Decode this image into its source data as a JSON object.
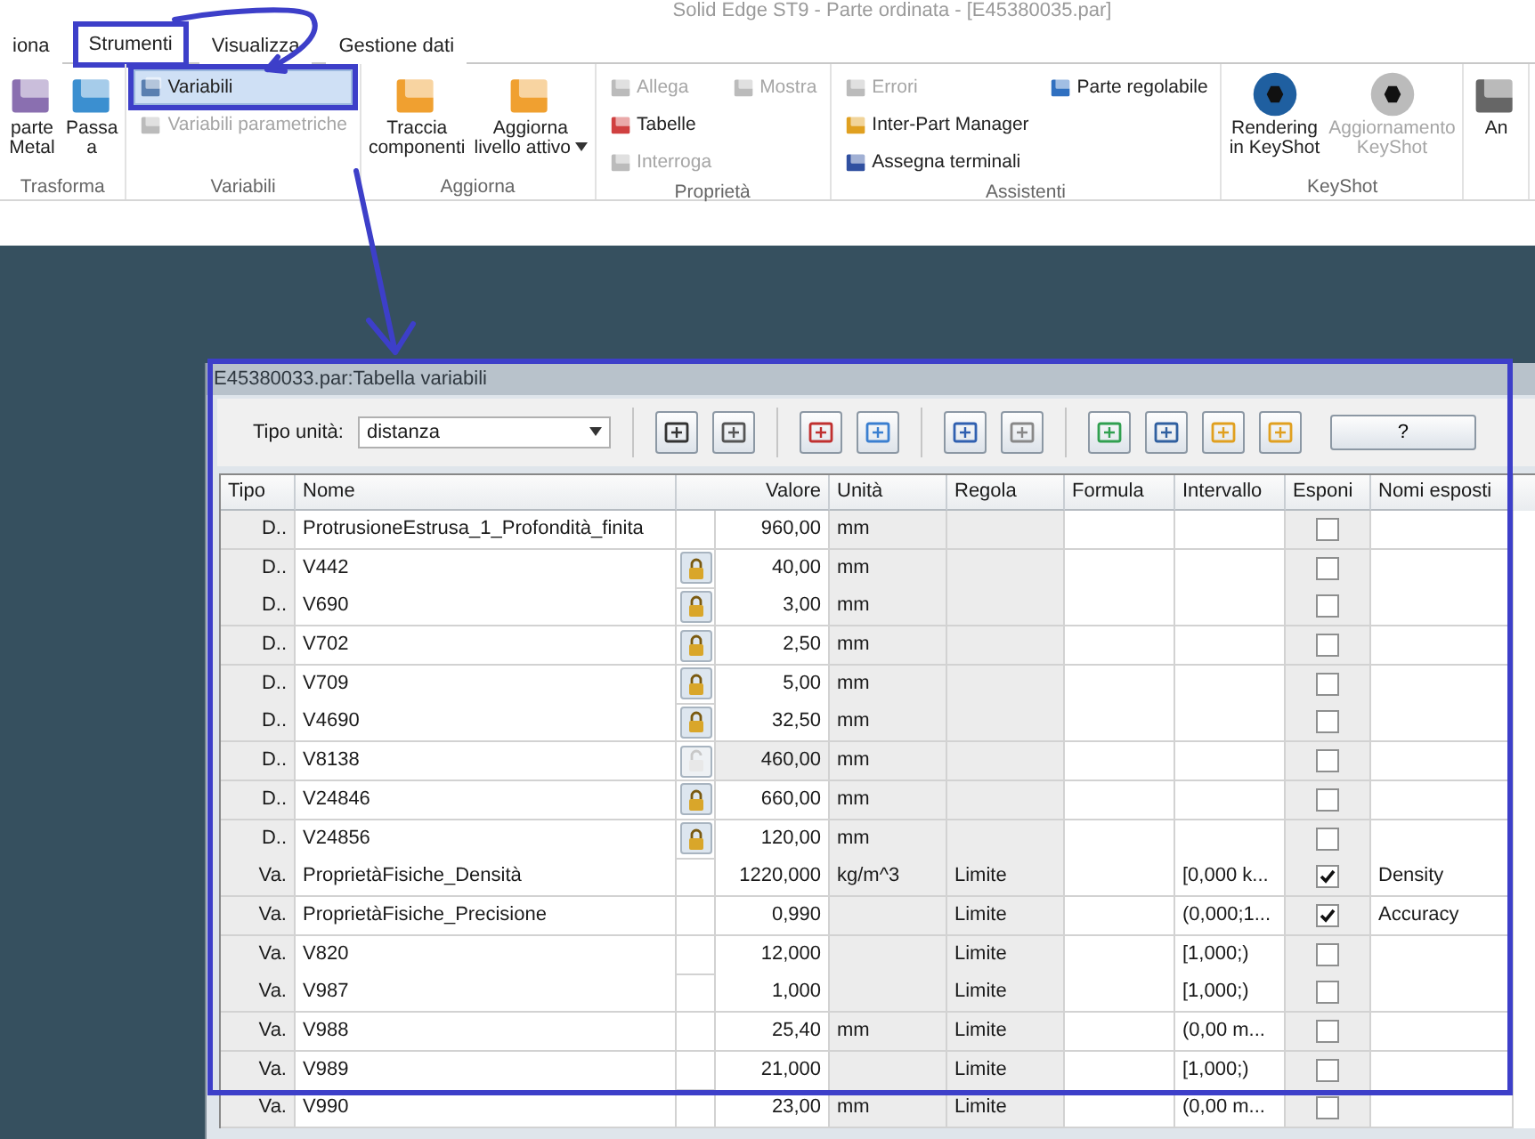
{
  "app_title": "Solid Edge ST9 - Parte ordinata - [E45380035.par]",
  "tabs": [
    {
      "label": "iona",
      "selected": false
    },
    {
      "label": "Strumenti",
      "selected": true
    },
    {
      "label": "Visualizza",
      "selected": false
    },
    {
      "label": "Gestione dati",
      "selected": false
    }
  ],
  "ribbon_groups": [
    {
      "label": "Trasforma",
      "columns": [
        [
          {
            "kind": "large",
            "label": "parte\nMetal",
            "disabled": false,
            "active": false
          }
        ],
        [
          {
            "kind": "large",
            "label": "Passa\na",
            "disabled": false,
            "active": false
          }
        ]
      ]
    },
    {
      "label": "Variabili",
      "columns": [
        [
          {
            "kind": "small",
            "label": "Variabili",
            "disabled": false,
            "active": true
          },
          {
            "kind": "small",
            "label": "Variabili parametriche",
            "disabled": true,
            "active": false
          }
        ]
      ]
    },
    {
      "label": "Aggiorna",
      "columns": [
        [
          {
            "kind": "large",
            "label": "Traccia\ncomponenti",
            "disabled": false,
            "active": false
          }
        ],
        [
          {
            "kind": "large",
            "label": "Aggiorna\nlivello attivo",
            "dropdown": true,
            "disabled": false,
            "active": false
          }
        ]
      ]
    },
    {
      "label": "Proprietà",
      "columns": [
        [
          {
            "kind": "small",
            "label": "Allega",
            "disabled": true,
            "active": false
          },
          {
            "kind": "small",
            "label": "Tabelle",
            "disabled": false,
            "active": false
          },
          {
            "kind": "small",
            "label": "Interroga",
            "disabled": true,
            "active": false
          }
        ],
        [
          {
            "kind": "small",
            "label": "Mostra",
            "disabled": true,
            "active": false
          }
        ]
      ]
    },
    {
      "label": "Assistenti",
      "columns": [
        [
          {
            "kind": "small",
            "label": "Errori",
            "disabled": true,
            "active": false
          },
          {
            "kind": "small",
            "label": "Inter-Part Manager",
            "disabled": false,
            "active": false
          },
          {
            "kind": "small",
            "label": "Assegna terminali",
            "disabled": false,
            "active": false
          }
        ],
        [
          {
            "kind": "small",
            "label": "Parte regolabile",
            "disabled": false,
            "active": false
          }
        ]
      ]
    },
    {
      "label": "KeyShot",
      "columns": [
        [
          {
            "kind": "large",
            "label": "Rendering\nin KeyShot",
            "disabled": false,
            "active": false
          }
        ],
        [
          {
            "kind": "large",
            "label": "Aggiornamento\nKeyShot",
            "disabled": true,
            "active": false
          }
        ]
      ]
    },
    {
      "columns": [
        [
          {
            "kind": "large",
            "label": "An",
            "disabled": false,
            "active": false
          }
        ]
      ]
    }
  ],
  "dialog": {
    "title": "E45380033.par:Tabella variabili",
    "unit_label": "Tipo unità:",
    "unit_value": "distanza",
    "help_label": "?"
  },
  "table": {
    "columns": [
      "Tipo",
      "Nome",
      "Valore",
      "Unità",
      "Regola",
      "Formula",
      "Intervallo",
      "Esponi",
      "Nomi esposti"
    ],
    "rows": [
      {
        "tipo": "D..",
        "nome": "ProtrusioneEstrusa_1_Profondità_finita",
        "lock_button": false,
        "valore": "960,00",
        "unita": "mm",
        "regola": "",
        "intervallo": "",
        "esponi": false,
        "nome_esposto": ""
      },
      {
        "tipo": "D..",
        "nome": "V442",
        "lock_button": true,
        "locked": true,
        "valore": "40,00",
        "unita": "mm",
        "regola": "",
        "intervallo": "",
        "esponi": false,
        "nome_esposto": ""
      },
      {
        "tipo": "D..",
        "nome": "V690",
        "lock_button": true,
        "locked": true,
        "valore": "3,00",
        "unita": "mm",
        "regola": "",
        "intervallo": "",
        "esponi": false,
        "nome_esposto": ""
      },
      {
        "tipo": "D..",
        "nome": "V702",
        "lock_button": true,
        "locked": true,
        "valore": "2,50",
        "unita": "mm",
        "regola": "",
        "intervallo": "",
        "esponi": false,
        "nome_esposto": ""
      },
      {
        "tipo": "D..",
        "nome": "V709",
        "lock_button": true,
        "locked": true,
        "valore": "5,00",
        "unita": "mm",
        "regola": "",
        "intervallo": "",
        "esponi": false,
        "nome_esposto": ""
      },
      {
        "tipo": "D..",
        "nome": "V4690",
        "lock_button": true,
        "locked": true,
        "valore": "32,50",
        "unita": "mm",
        "regola": "",
        "intervallo": "",
        "esponi": false,
        "nome_esposto": ""
      },
      {
        "tipo": "D..",
        "nome": "V8138",
        "lock_button": true,
        "locked": false,
        "valore": "460,00",
        "unita": "mm",
        "regola": "",
        "intervallo": "",
        "esponi": false,
        "nome_esposto": ""
      },
      {
        "tipo": "D..",
        "nome": "V24846",
        "lock_button": true,
        "locked": true,
        "valore": "660,00",
        "unita": "mm",
        "regola": "",
        "intervallo": "",
        "esponi": false,
        "nome_esposto": ""
      },
      {
        "tipo": "D..",
        "nome": "V24856",
        "lock_button": true,
        "locked": true,
        "valore": "120,00",
        "unita": "mm",
        "regola": "",
        "intervallo": "",
        "esponi": false,
        "nome_esposto": ""
      },
      {
        "tipo": "Va.",
        "nome": "ProprietàFisiche_Densità",
        "lock_button": false,
        "valore": "1220,000",
        "unita": "kg/m^3",
        "regola": "Limite",
        "intervallo": "[0,000 k...",
        "esponi": true,
        "nome_esposto": "Density"
      },
      {
        "tipo": "Va.",
        "nome": "ProprietàFisiche_Precisione",
        "lock_button": false,
        "valore": "0,990",
        "unita": "",
        "regola": "Limite",
        "intervallo": "(0,000;1...",
        "esponi": true,
        "nome_esposto": "Accuracy"
      },
      {
        "tipo": "Va.",
        "nome": "V820",
        "lock_button": false,
        "valore": "12,000",
        "unita": "",
        "regola": "Limite",
        "intervallo": "[1,000;)",
        "esponi": false,
        "nome_esposto": ""
      },
      {
        "tipo": "Va.",
        "nome": "V987",
        "lock_button": false,
        "valore": "1,000",
        "unita": "",
        "regola": "Limite",
        "intervallo": "[1,000;)",
        "esponi": false,
        "nome_esposto": ""
      },
      {
        "tipo": "Va.",
        "nome": "V988",
        "lock_button": false,
        "valore": "25,40",
        "unita": "mm",
        "regola": "Limite",
        "intervallo": "(0,00 m...",
        "esponi": false,
        "nome_esposto": ""
      },
      {
        "tipo": "Va.",
        "nome": "V989",
        "lock_button": false,
        "valore": "21,000",
        "unita": "",
        "regola": "Limite",
        "intervallo": "[1,000;)",
        "esponi": false,
        "nome_esposto": ""
      },
      {
        "tipo": "Va.",
        "nome": "V990",
        "lock_button": false,
        "valore": "23,00",
        "unita": "mm",
        "regola": "Limite",
        "intervallo": "(0,00 m...",
        "esponi": false,
        "nome_esposto": ""
      }
    ]
  }
}
